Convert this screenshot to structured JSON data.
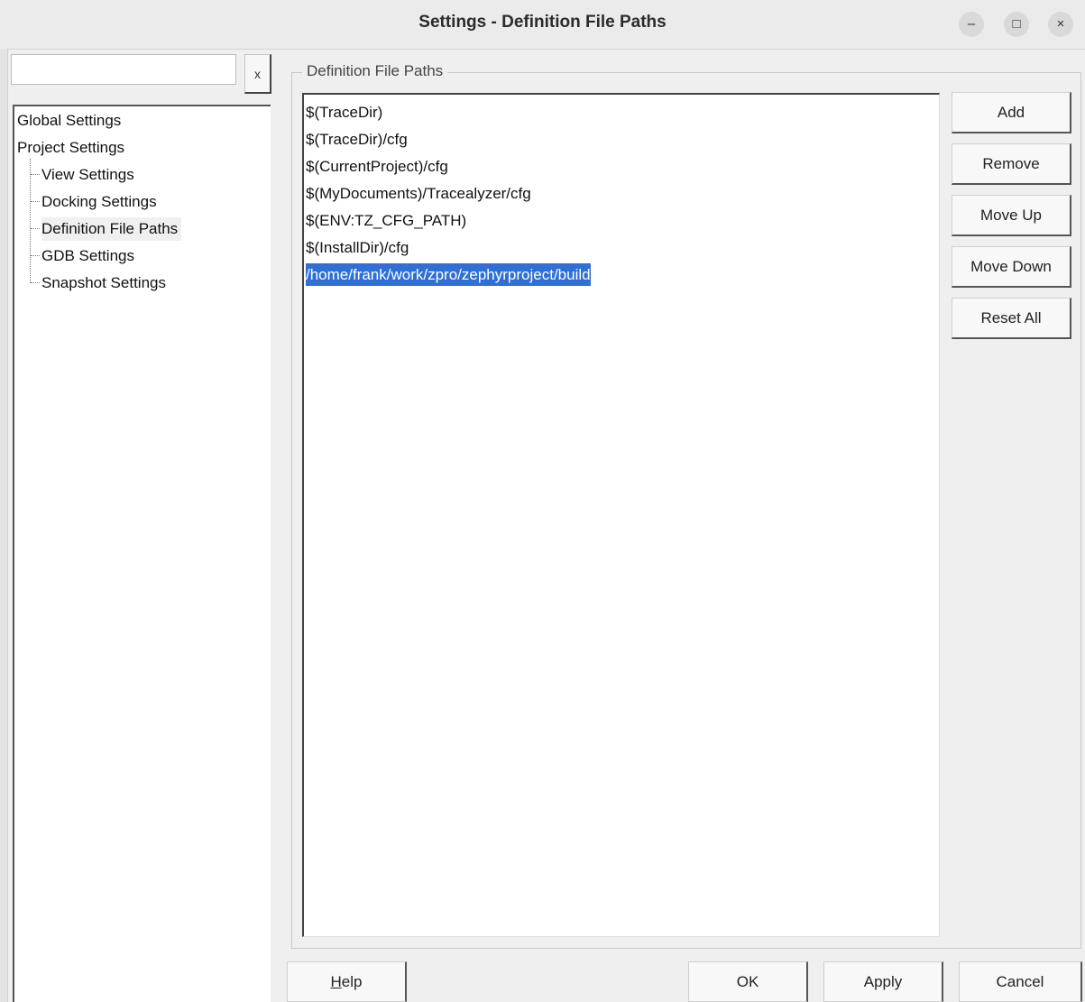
{
  "window": {
    "title": "Settings - Definition File Paths",
    "minimize_glyph": "–",
    "maximize_glyph": "□",
    "close_glyph": "×"
  },
  "search": {
    "value": "",
    "placeholder": "",
    "clear_label": "x"
  },
  "tree": {
    "items": [
      {
        "label": "Global Settings",
        "level": 0
      },
      {
        "label": "Project Settings",
        "level": 0
      },
      {
        "label": "View Settings",
        "level": 1
      },
      {
        "label": "Docking Settings",
        "level": 1
      },
      {
        "label": "Definition File Paths",
        "level": 1,
        "selected": true
      },
      {
        "label": "GDB Settings",
        "level": 1
      },
      {
        "label": "Snapshot Settings",
        "level": 1
      }
    ]
  },
  "panel": {
    "group_title": "Definition File Paths",
    "paths": [
      "$(TraceDir)",
      "$(TraceDir)/cfg",
      "$(CurrentProject)/cfg",
      "$(MyDocuments)/Tracealyzer/cfg",
      "$(ENV:TZ_CFG_PATH)",
      "$(InstallDir)/cfg",
      "/home/frank/work/zpro/zephyrproject/build"
    ],
    "selected_index": 6,
    "buttons": {
      "add": "Add",
      "remove": "Remove",
      "move_up": "Move Up",
      "move_down": "Move Down",
      "reset_all": "Reset All"
    }
  },
  "footer": {
    "help": "Help",
    "ok": "OK",
    "apply": "Apply",
    "cancel": "Cancel"
  },
  "colors": {
    "selection": "#2f6fd6",
    "background": "#efefef"
  }
}
